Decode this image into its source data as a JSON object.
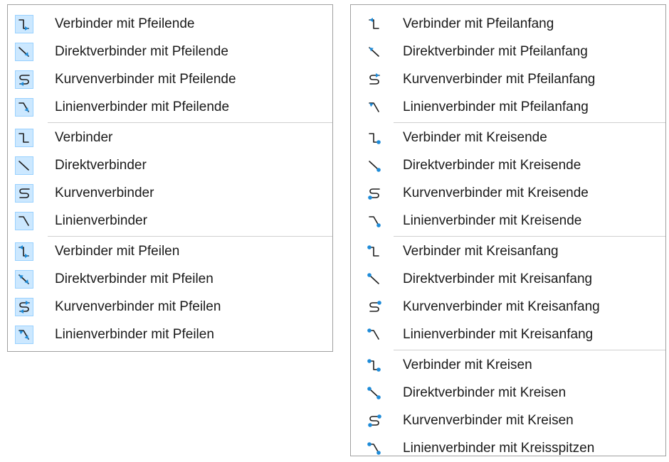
{
  "left_menu": {
    "groups": [
      [
        {
          "label": "Verbinder mit Pfeilende",
          "icon": "connector-arrow-end-icon",
          "shape": "step",
          "ends": "arrow-end"
        },
        {
          "label": "Direktverbinder mit Pfeilende",
          "icon": "straight-connector-arrow-end-icon",
          "shape": "diag",
          "ends": "arrow-end"
        },
        {
          "label": "Kurvenverbinder mit Pfeilende",
          "icon": "curved-connector-arrow-end-icon",
          "shape": "curve",
          "ends": "arrow-end"
        },
        {
          "label": "Linienverbinder mit Pfeilende",
          "icon": "line-connector-arrow-end-icon",
          "shape": "line",
          "ends": "arrow-end"
        }
      ],
      [
        {
          "label": "Verbinder",
          "icon": "connector-icon",
          "shape": "step",
          "ends": "plain"
        },
        {
          "label": "Direktverbinder",
          "icon": "straight-connector-icon",
          "shape": "diag",
          "ends": "plain"
        },
        {
          "label": "Kurvenverbinder",
          "icon": "curved-connector-icon",
          "shape": "curve",
          "ends": "plain"
        },
        {
          "label": "Linienverbinder",
          "icon": "line-connector-icon",
          "shape": "line",
          "ends": "plain"
        }
      ],
      [
        {
          "label": "Verbinder mit Pfeilen",
          "icon": "connector-arrows-icon",
          "shape": "step",
          "ends": "arrows"
        },
        {
          "label": "Direktverbinder mit Pfeilen",
          "icon": "straight-connector-arrows-icon",
          "shape": "diag",
          "ends": "arrows"
        },
        {
          "label": "Kurvenverbinder mit Pfeilen",
          "icon": "curved-connector-arrows-icon",
          "shape": "curve",
          "ends": "arrows"
        },
        {
          "label": "Linienverbinder mit Pfeilen",
          "icon": "line-connector-arrows-icon",
          "shape": "line",
          "ends": "arrows"
        }
      ]
    ]
  },
  "right_menu": {
    "groups": [
      [
        {
          "label": "Verbinder mit Pfeilanfang",
          "icon": "connector-arrow-start-icon",
          "shape": "step",
          "ends": "arrow-start"
        },
        {
          "label": "Direktverbinder mit Pfeilanfang",
          "icon": "straight-connector-arrow-start-icon",
          "shape": "diag",
          "ends": "arrow-start"
        },
        {
          "label": "Kurvenverbinder mit Pfeilanfang",
          "icon": "curved-connector-arrow-start-icon",
          "shape": "curve",
          "ends": "arrow-start"
        },
        {
          "label": "Linienverbinder mit Pfeilanfang",
          "icon": "line-connector-arrow-start-icon",
          "shape": "line",
          "ends": "arrow-start"
        }
      ],
      [
        {
          "label": "Verbinder mit Kreisende",
          "icon": "connector-circle-end-icon",
          "shape": "step",
          "ends": "circle-end"
        },
        {
          "label": "Direktverbinder mit Kreisende",
          "icon": "straight-connector-circle-end-icon",
          "shape": "diag",
          "ends": "circle-end"
        },
        {
          "label": "Kurvenverbinder mit Kreisende",
          "icon": "curved-connector-circle-end-icon",
          "shape": "curve",
          "ends": "circle-end"
        },
        {
          "label": "Linienverbinder mit Kreisende",
          "icon": "line-connector-circle-end-icon",
          "shape": "line",
          "ends": "circle-end"
        }
      ],
      [
        {
          "label": "Verbinder mit Kreisanfang",
          "icon": "connector-circle-start-icon",
          "shape": "step",
          "ends": "circle-start"
        },
        {
          "label": "Direktverbinder mit Kreisanfang",
          "icon": "straight-connector-circle-start-icon",
          "shape": "diag",
          "ends": "circle-start"
        },
        {
          "label": "Kurvenverbinder mit Kreisanfang",
          "icon": "curved-connector-circle-start-icon",
          "shape": "curve",
          "ends": "circle-start"
        },
        {
          "label": "Linienverbinder mit Kreisanfang",
          "icon": "line-connector-circle-start-icon",
          "shape": "line",
          "ends": "circle-start"
        }
      ],
      [
        {
          "label": "Verbinder mit Kreisen",
          "icon": "connector-circles-icon",
          "shape": "step",
          "ends": "circles"
        },
        {
          "label": "Direktverbinder mit Kreisen",
          "icon": "straight-connector-circles-icon",
          "shape": "diag",
          "ends": "circles"
        },
        {
          "label": "Kurvenverbinder mit Kreisen",
          "icon": "curved-connector-circles-icon",
          "shape": "curve",
          "ends": "circles"
        },
        {
          "label": "Linienverbinder mit Kreisspitzen",
          "icon": "line-connector-circles-icon",
          "shape": "line",
          "ends": "circles"
        }
      ]
    ]
  },
  "colors": {
    "icon_line": "#1e1e1e",
    "icon_accent": "#1e8bd8",
    "selected_bg": "#cce8ff",
    "selected_border": "#99d1ff"
  }
}
